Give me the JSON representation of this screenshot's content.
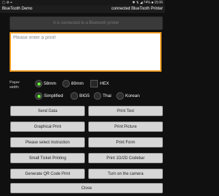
{
  "statusbar": {
    "left_icons": "▢ ⚙ ⌖",
    "right": "✱ ⇅ ◢ 74% ■ 15:06"
  },
  "titlebar": {
    "app_name": "BlueTooth Demo",
    "status": "connected BlueTooth Printer"
  },
  "connected_banner": "It is connected to a Bluetooth printer",
  "print_input": {
    "placeholder": "Please enter a print!",
    "value": ""
  },
  "paper": {
    "label_line1": "Paper",
    "label_line2": "width:",
    "width_options": [
      "58mm",
      "80mm"
    ],
    "selected_width": "58mm",
    "hex_label": "HEX",
    "hex_checked": false
  },
  "encoding": {
    "options": [
      "Simplified",
      "BIG5",
      "Thai",
      "Korean"
    ],
    "selected": "Simplified"
  },
  "buttons": {
    "send_data": "Send Data",
    "print_test": "Print Test",
    "graphical_print": "Graphical Print",
    "print_picture": "Print Picture",
    "select_instruction": "Please select instruction",
    "print_form": "Print Form",
    "small_ticket": "Small Ticket Printing",
    "print_codebar": "Print 1D/2D Codebar",
    "qr_print": "Generate QR Code Print",
    "camera": "Turn on the camera",
    "close": "Close"
  },
  "colors": {
    "accent_border": "#f39c1d",
    "radio_selected": "#6cff3a",
    "button_bg": "#d6d6d6"
  }
}
